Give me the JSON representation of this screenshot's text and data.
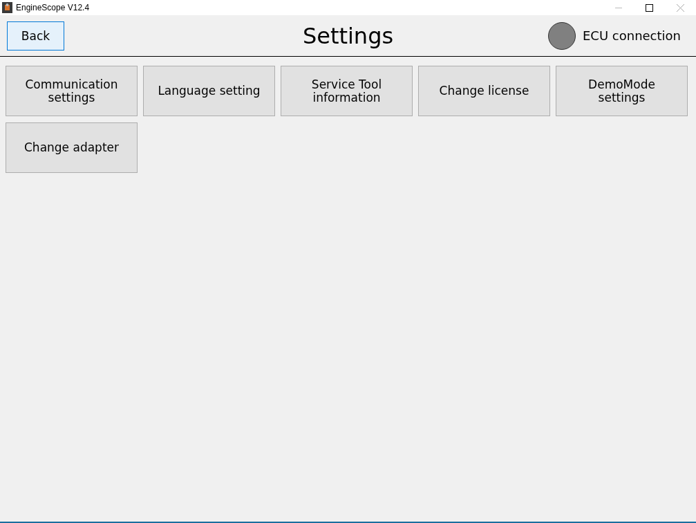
{
  "window": {
    "title": "EngineScope V12.4"
  },
  "header": {
    "back_button": "Back",
    "title": "Settings",
    "ecu": {
      "label": "ECU connection",
      "connected": false
    }
  },
  "buttons": [
    {
      "label": "Communication\nsettings"
    },
    {
      "label": "Language setting"
    },
    {
      "label": "Service Tool\ninformation"
    },
    {
      "label": "Change license"
    },
    {
      "label": "DemoMode\nsettings"
    },
    {
      "label": "Change adapter"
    }
  ]
}
